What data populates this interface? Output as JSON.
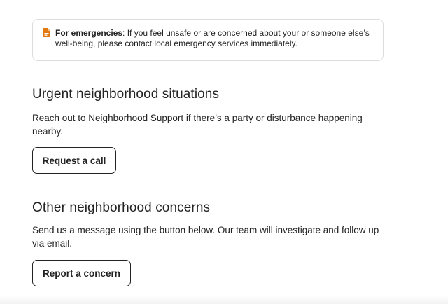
{
  "notice": {
    "icon": "document-icon",
    "icon_color": "#E07912",
    "label": "For emergencies",
    "text": ": If you feel unsafe or are concerned about your or someone else’s well-being, please contact local emergency services immediately."
  },
  "urgent": {
    "title": "Urgent neighborhood situations",
    "body": "Reach out to Neighborhood Support if there’s a party or disturbance happening nearby.",
    "button_label": "Request a call"
  },
  "other": {
    "title": "Other neighborhood concerns",
    "body": "Send us a message using the button below. Our team will investigate and follow up via email.",
    "button_label": "Report a concern"
  }
}
